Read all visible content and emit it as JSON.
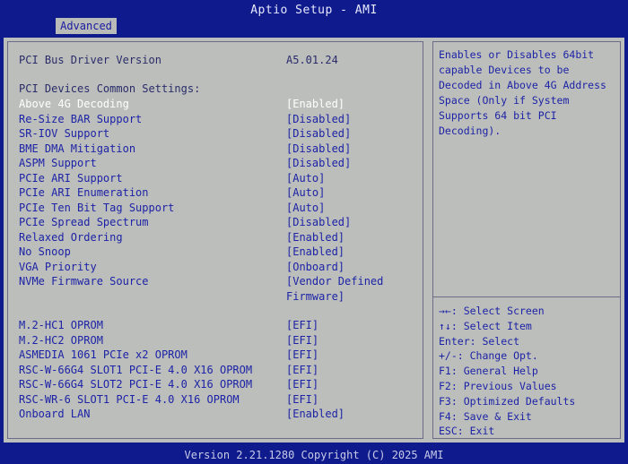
{
  "header": {
    "title": "Aptio Setup - AMI",
    "tab": "Advanced"
  },
  "settings": {
    "driver_version": {
      "label": "PCI Bus Driver Version",
      "value": "A5.01.24"
    },
    "section_heading": "PCI Devices Common Settings:",
    "items": [
      {
        "label": "Above 4G Decoding",
        "value": "[Enabled]"
      },
      {
        "label": "Re-Size BAR Support",
        "value": "[Disabled]"
      },
      {
        "label": "SR-IOV Support",
        "value": "[Disabled]"
      },
      {
        "label": "BME DMA Mitigation",
        "value": "[Disabled]"
      },
      {
        "label": "ASPM Support",
        "value": "[Disabled]"
      },
      {
        "label": "PCIe ARI Support",
        "value": "[Auto]"
      },
      {
        "label": "PCIe ARI Enumeration",
        "value": "[Auto]"
      },
      {
        "label": "PCIe Ten Bit Tag Support",
        "value": "[Auto]"
      },
      {
        "label": "PCIe Spread Spectrum",
        "value": "[Disabled]"
      },
      {
        "label": "Relaxed Ordering",
        "value": "[Enabled]"
      },
      {
        "label": "No Snoop",
        "value": "[Enabled]"
      },
      {
        "label": "VGA Priority",
        "value": "[Onboard]"
      },
      {
        "label": "NVMe Firmware Source",
        "value": "[Vendor Defined",
        "value_line2": "Firmware]"
      }
    ],
    "oprom_items": [
      {
        "label": "M.2-HC1 OPROM",
        "value": "[EFI]"
      },
      {
        "label": "M.2-HC2 OPROM",
        "value": "[EFI]"
      },
      {
        "label": "ASMEDIA 1061 PCIe x2 OPROM",
        "value": "[EFI]"
      },
      {
        "label": "RSC-W-66G4 SLOT1 PCI-E 4.0 X16 OPROM",
        "value": "[EFI]"
      },
      {
        "label": "RSC-W-66G4 SLOT2 PCI-E 4.0 X16 OPROM",
        "value": "[EFI]"
      },
      {
        "label": "RSC-WR-6 SLOT1 PCI-E 4.0 X16 OPROM",
        "value": "[EFI]"
      },
      {
        "label": "Onboard LAN",
        "value": "[Enabled]"
      }
    ]
  },
  "help": {
    "lines": [
      "Enables or Disables 64bit",
      "capable Devices to be",
      "Decoded in Above 4G Address",
      "Space (Only if System",
      "Supports 64 bit PCI",
      "Decoding)."
    ]
  },
  "keys": [
    "→←: Select Screen",
    "↑↓: Select Item",
    "Enter: Select",
    "+/-: Change Opt.",
    "F1: General Help",
    "F2: Previous Values",
    "F3: Optimized Defaults",
    "F4: Save & Exit",
    "ESC: Exit"
  ],
  "footer": "Version 2.21.1280 Copyright (C) 2025 AMI",
  "colors": {
    "frame": "#0f1b8c",
    "panel": "#bcbebb",
    "option_text": "#1d23a6",
    "selected_text": "#ffffff"
  }
}
